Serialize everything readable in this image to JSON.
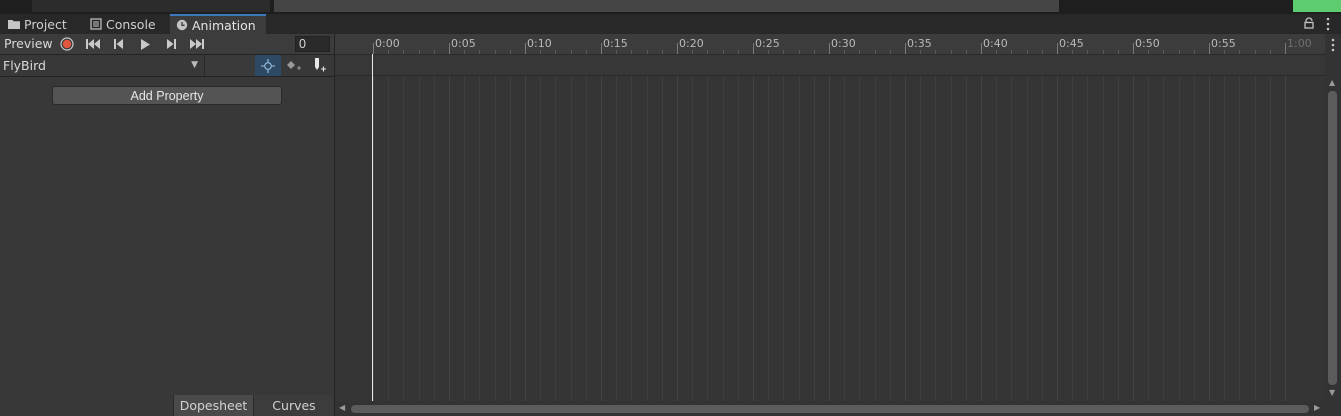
{
  "colors": {
    "accent_tab": "#3a79bb",
    "record_red": "#e0563f",
    "green_block": "#5ccc6e",
    "ripple_bg": "#2c4a63"
  },
  "tabs": [
    {
      "label": "Project",
      "icon": "folder-icon"
    },
    {
      "label": "Console",
      "icon": "console-icon"
    },
    {
      "label": "Animation",
      "icon": "clock-icon",
      "active": true
    }
  ],
  "toolbar": {
    "preview_label": "Preview",
    "frame_value": "0",
    "buttons": [
      "record-icon",
      "first-key-icon",
      "prev-key-icon",
      "play-icon",
      "next-key-icon",
      "last-key-icon"
    ]
  },
  "clip": {
    "name": "FlyBird"
  },
  "panel": {
    "add_property_label": "Add Property"
  },
  "bottom_tabs": [
    {
      "label": "Dopesheet",
      "active": true
    },
    {
      "label": "Curves"
    }
  ],
  "ruler": {
    "labels": [
      "0:00",
      "0:05",
      "0:10",
      "0:15",
      "0:20",
      "0:25",
      "0:30",
      "0:35",
      "0:40",
      "0:45",
      "0:50",
      "0:55",
      "1:00"
    ],
    "last_label_dim": true
  }
}
